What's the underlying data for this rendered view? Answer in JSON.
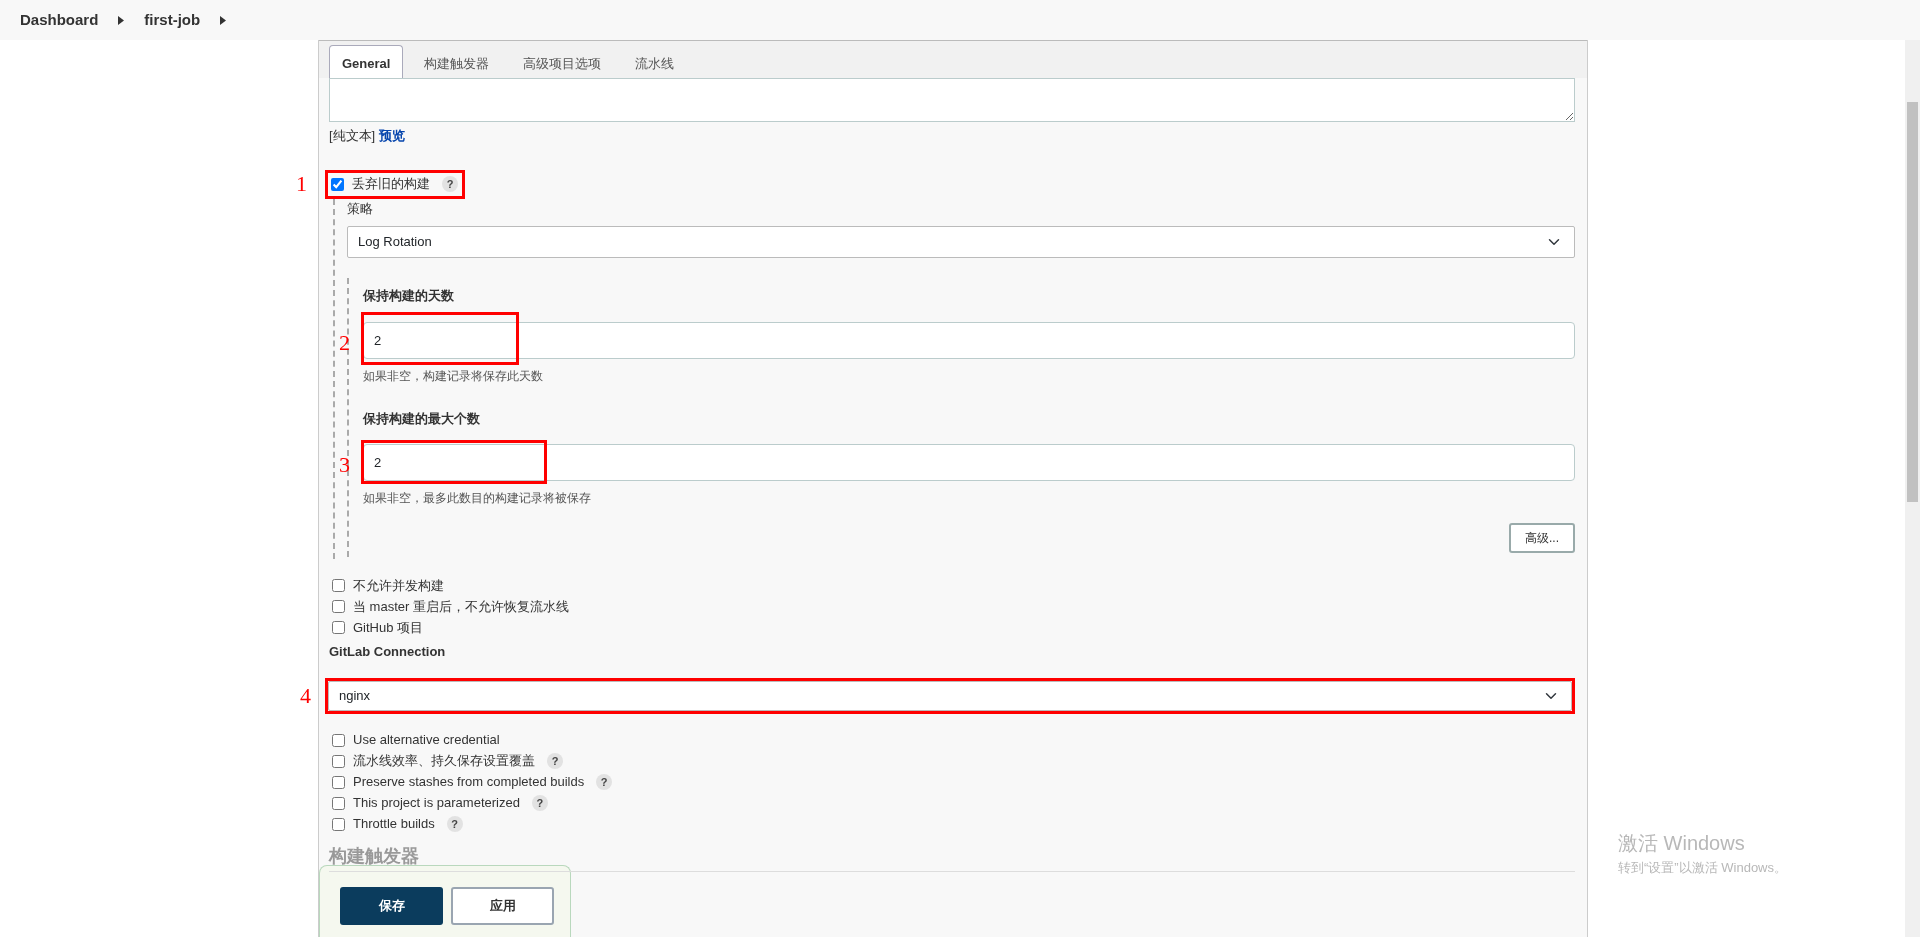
{
  "breadcrumbs": [
    {
      "label": "Dashboard"
    },
    {
      "label": "first-job"
    }
  ],
  "tabs": [
    {
      "label": "General",
      "selected": true
    },
    {
      "label": "构建触发器",
      "selected": false
    },
    {
      "label": "高级项目选项",
      "selected": false
    },
    {
      "label": "流水线",
      "selected": false
    }
  ],
  "description": {
    "format_label": "[纯文本]",
    "preview_link": "预览"
  },
  "discard_old_builds": {
    "label": "丢弃旧的构建",
    "checked": true,
    "help": "?",
    "annotation": "1",
    "strategy_label": "策略",
    "strategy": "Log Rotation",
    "fields": [
      {
        "label": "保持构建的天数",
        "value": "2",
        "help_text": "如果非空，构建记录将保存此天数",
        "annotation": "2"
      },
      {
        "label": "保持构建的最大个数",
        "value": "2",
        "help_text": "如果非空，最多此数目的构建记录将被保存",
        "annotation": "3"
      }
    ],
    "advanced_button": "高级..."
  },
  "options": [
    {
      "label": "不允许并发构建",
      "checked": false
    },
    {
      "label": "当 master 重启后，不允许恢复流水线",
      "checked": false
    },
    {
      "label": "GitHub 项目",
      "checked": false
    }
  ],
  "gitlab": {
    "label": "GitLab Connection",
    "value": "nginx",
    "annotation": "4"
  },
  "more_options": [
    {
      "label": "Use alternative credential",
      "checked": false
    },
    {
      "label": "流水线效率、持久保存设置覆盖",
      "checked": false,
      "help": "?"
    },
    {
      "label": "Preserve stashes from completed builds",
      "checked": false,
      "help": "?"
    },
    {
      "label": "This project is parameterized",
      "checked": false,
      "help": "?"
    },
    {
      "label": "Throttle builds",
      "checked": false,
      "help": "?"
    }
  ],
  "next_section": {
    "title": "构建触发器"
  },
  "actions": [
    {
      "label": "保存",
      "kind": "primary"
    },
    {
      "label": "应用",
      "kind": "secondary"
    }
  ],
  "os_notice": {
    "title": "激活 Windows",
    "text": "转到“设置”以激活 Windows。"
  }
}
